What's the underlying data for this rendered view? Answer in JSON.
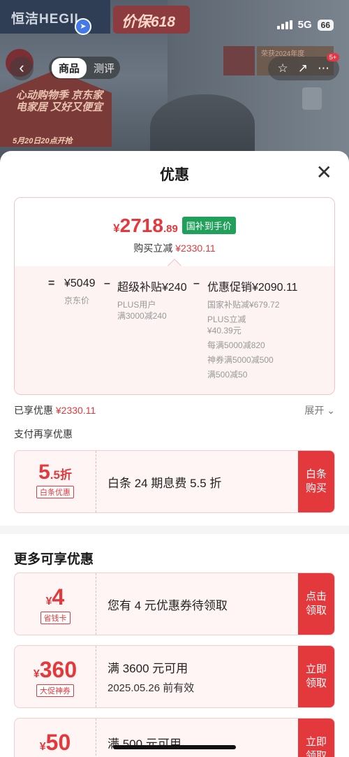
{
  "status_bar": {
    "network": "5G",
    "battery": "66"
  },
  "background": {
    "brand": "恒洁HEGII",
    "promo": "价保618",
    "house_text": "心动购物季 京东家电家居 又好又便宜",
    "house_date": "5月20日20点开抢",
    "award": "荣获2024年度"
  },
  "navbar": {
    "tabs": [
      "商品",
      "测评"
    ],
    "cart_count": "5+"
  },
  "sheet": {
    "title": "优惠",
    "final_price": {
      "currency": "¥",
      "integer": "2718",
      "decimal": ".89"
    },
    "gov_tag": "国补到手价",
    "reduce_label": "购买立减",
    "reduce_amount": "¥2330.11",
    "formula": {
      "equals": "=",
      "minus": "–",
      "base_price": "¥5049",
      "base_label": "京东价",
      "super_subsidy": "超级补贴¥240",
      "super_lines": [
        "PLUS用户",
        "满3000减240"
      ],
      "promo_total": "优惠促销¥2090.11",
      "promo_lines": [
        "国家补贴减¥679.72",
        "PLUS立减",
        "¥40.39元",
        "每满5000减820",
        "神券满5000减500",
        "满500减50"
      ]
    },
    "enjoyed_label": "已享优惠",
    "enjoyed_amount": "¥2330.11",
    "expand_label": "展开",
    "pay_label": "支付再享优惠",
    "baitiao": {
      "value_main": "5",
      "value_dec": ".5",
      "value_unit": "折",
      "tag": "白条优惠",
      "text": "白条 24 期息费 5.5 折",
      "action": "白条购买"
    },
    "more_title": "更多可享优惠",
    "coupons": [
      {
        "currency": "¥",
        "value": "4",
        "tag": "省钱卡",
        "text": "您有 4 元优惠券待领取",
        "sub": "",
        "action": "点击领取"
      },
      {
        "currency": "¥",
        "value": "360",
        "tag": "大促神券",
        "text": "满 3600 元可用",
        "sub": "2025.05.26 前有效",
        "action": "立即领取"
      },
      {
        "currency": "¥",
        "value": "50",
        "tag": "",
        "text": "满 500 元可用",
        "sub": "",
        "action": "立即领取"
      }
    ]
  }
}
